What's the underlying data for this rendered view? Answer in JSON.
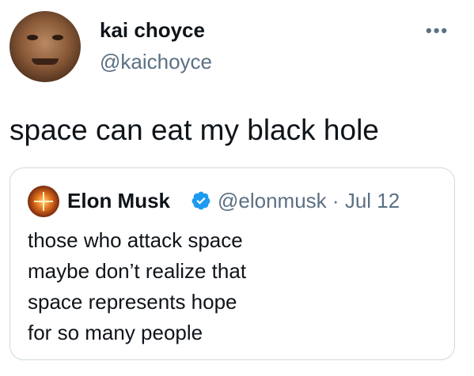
{
  "tweet": {
    "author_name": "kai choyce",
    "author_handle": "@kaichoyce",
    "more_label": "•••",
    "text": "space can eat my black hole",
    "avatar_icon": "user-avatar-photo",
    "quoted": {
      "author_name": "Elon Musk",
      "author_handle": "@elonmusk",
      "separator": "·",
      "date": "Jul 12",
      "verified_icon": "verified-badge-icon",
      "verified_color": "#1d9bf0",
      "lines": [
        "those who attack space",
        "maybe don’t realize that",
        "space represents hope",
        "for so many people"
      ]
    }
  }
}
